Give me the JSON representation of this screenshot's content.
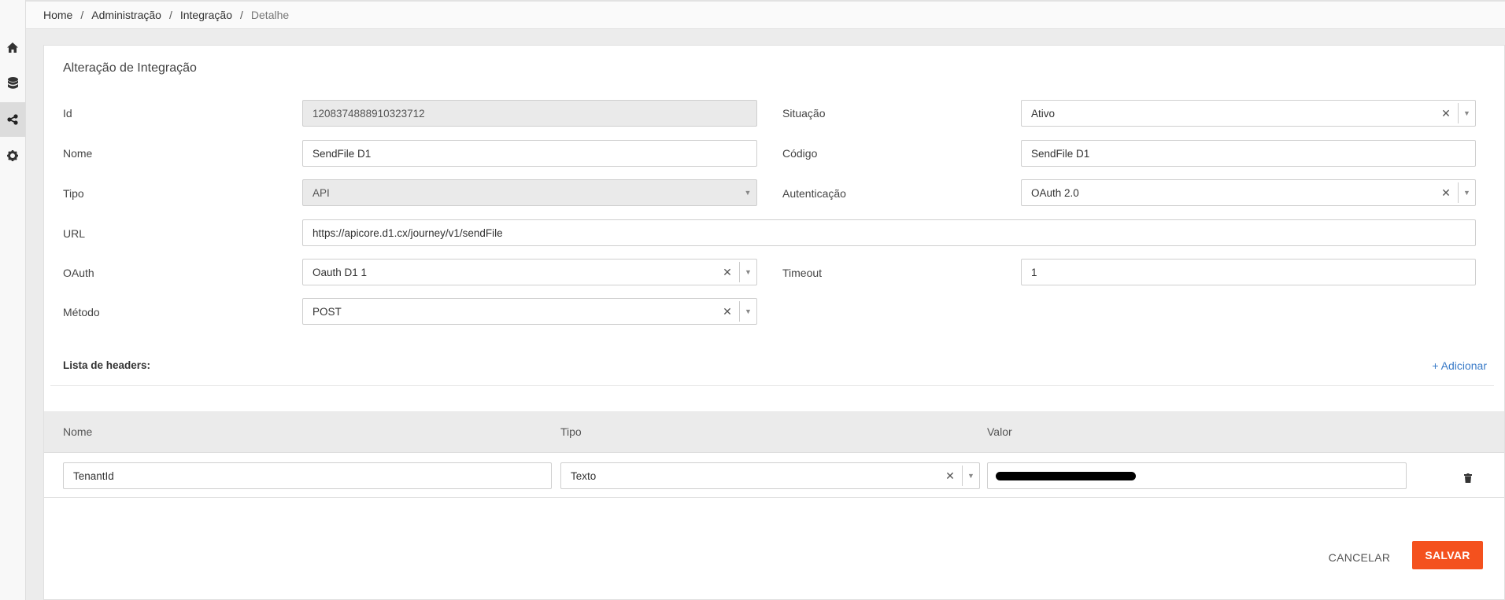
{
  "breadcrumb": [
    "Home",
    "Administração",
    "Integração",
    "Detalhe"
  ],
  "sidebar": [
    {
      "icon": "home-icon"
    },
    {
      "icon": "database-icon"
    },
    {
      "icon": "share-icon",
      "active": true
    },
    {
      "icon": "gear-icon"
    }
  ],
  "form": {
    "title": "Alteração de Integração",
    "id_label": "Id",
    "id_value": "1208374888910323712",
    "situacao_label": "Situação",
    "situacao_value": "Ativo",
    "nome_label": "Nome",
    "nome_value": "SendFile D1",
    "codigo_label": "Código",
    "codigo_value": "SendFile D1",
    "tipo_label": "Tipo",
    "tipo_value": "API",
    "autenticacao_label": "Autenticação",
    "autenticacao_value": "OAuth 2.0",
    "url_label": "URL",
    "url_value": "https://apicore.d1.cx/journey/v1/sendFile",
    "oauth_label": "OAuth",
    "oauth_value": "Oauth D1 1",
    "timeout_label": "Timeout",
    "timeout_value": "1",
    "metodo_label": "Método",
    "metodo_value": "POST"
  },
  "headers": {
    "section_label": "Lista de headers:",
    "add_label": "+ Adicionar",
    "columns": [
      "Nome",
      "Tipo",
      "Valor"
    ],
    "rows": [
      {
        "nome": "TenantId",
        "tipo": "Texto",
        "valor": ""
      }
    ]
  },
  "actions": {
    "cancel": "CANCELAR",
    "save": "SALVAR"
  },
  "colors": {
    "accent": "#f4511e",
    "link": "#3a7bc8"
  }
}
